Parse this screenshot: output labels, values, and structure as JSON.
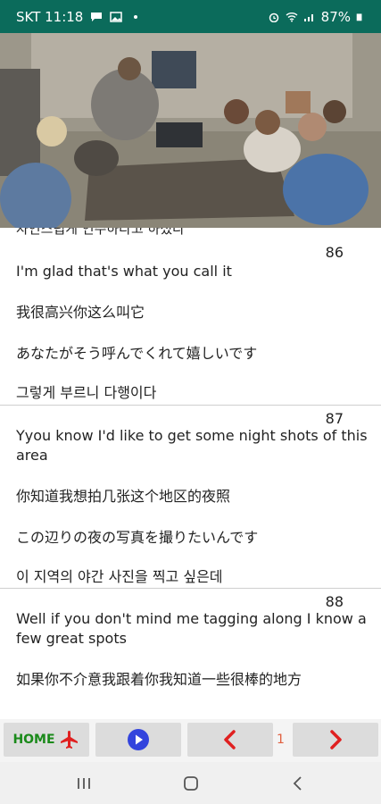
{
  "status_bar": {
    "carrier_time": "SKT 11:18",
    "battery": "87%",
    "icons": [
      "chat-icon",
      "photo-icon",
      "dot-icon",
      "alarm-icon",
      "wifi-icon",
      "signal-icon",
      "battery-icon"
    ]
  },
  "video": {
    "description_icon": "video-frame"
  },
  "subtitles": {
    "partial_top": "자연스럽게 연주하라고 하셨다",
    "entries": [
      {
        "number": "86",
        "english": "I'm glad that's what you call it",
        "chinese": "我很高兴你这么叫它",
        "japanese": "あなたがそう呼んでくれて嬉しいです",
        "korean": "그렇게 부르니 다행이다"
      },
      {
        "number": "87",
        "english": "Yyou know I'd like to get some night shots of this area",
        "chinese": "你知道我想拍几张这个地区的夜照",
        "japanese": "この辺りの夜の写真を撮りたいんです",
        "korean": "이 지역의 야간 사진을 찍고 싶은데"
      },
      {
        "number": "88",
        "english": "Well if you don't mind me tagging along I know a few great spots",
        "chinese": "如果你不介意我跟着你我知道一些很棒的地方"
      }
    ]
  },
  "toolbar": {
    "home_label": "HOME",
    "page_number": "1",
    "icons": [
      "airplane-icon",
      "play-icon",
      "chevron-left-icon",
      "chevron-right-icon"
    ],
    "colors": {
      "home": "#1a8a1a",
      "accent": "#e02020",
      "play": "#3344dd"
    }
  },
  "nav_bar": {
    "icons": [
      "recent-apps-icon",
      "home-circle-icon",
      "back-icon"
    ]
  }
}
